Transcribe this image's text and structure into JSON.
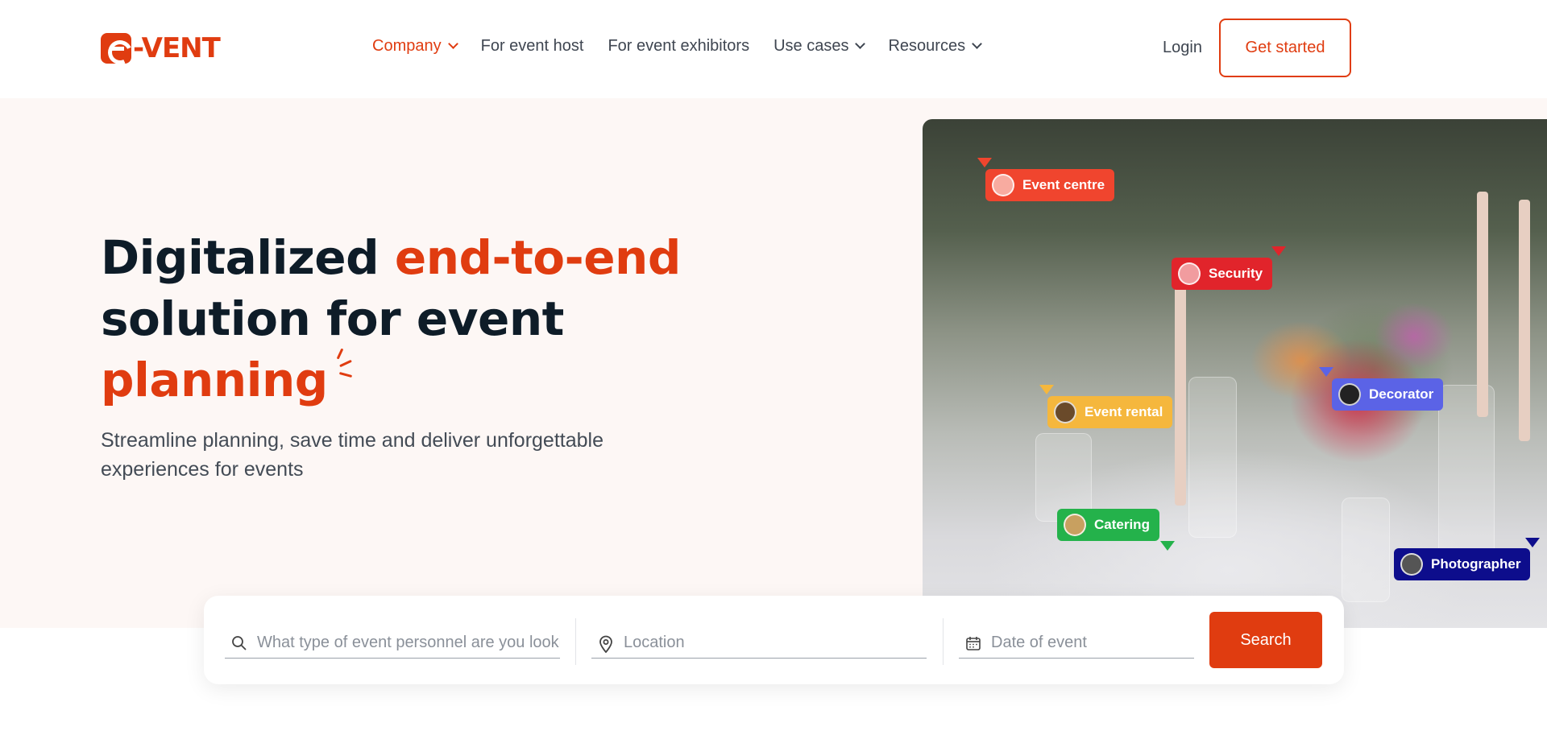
{
  "brand": {
    "logo_text": "-VENT",
    "accent_color": "#e03c10"
  },
  "nav": {
    "items": [
      {
        "label": "Company",
        "has_dropdown": true,
        "active": true
      },
      {
        "label": "For event host",
        "has_dropdown": false
      },
      {
        "label": "For event exhibitors",
        "has_dropdown": false
      },
      {
        "label": "Use cases",
        "has_dropdown": true
      },
      {
        "label": "Resources",
        "has_dropdown": true
      }
    ],
    "login_label": "Login",
    "cta_label": "Get started"
  },
  "hero": {
    "headline": {
      "part1": "Digitalized ",
      "part1_accent": "end-to-end",
      "part2": "solution for event",
      "part3_accent": "planning"
    },
    "subhead": "Streamline planning, save time and deliver unforgettable experiences for events",
    "tags": [
      {
        "label": "Event centre",
        "color": "#f0452e"
      },
      {
        "label": "Security",
        "color": "#e1242b"
      },
      {
        "label": "Decorator",
        "color": "#5b63e6"
      },
      {
        "label": "Event rental",
        "color": "#f5b73d"
      },
      {
        "label": "Catering",
        "color": "#24b24b"
      },
      {
        "label": "Photographer",
        "color": "#0d0d8c"
      }
    ]
  },
  "search": {
    "personnel_placeholder": "What type of event personnel are you looking for?",
    "location_placeholder": "Location",
    "date_placeholder": "Date of event",
    "button_label": "Search"
  }
}
